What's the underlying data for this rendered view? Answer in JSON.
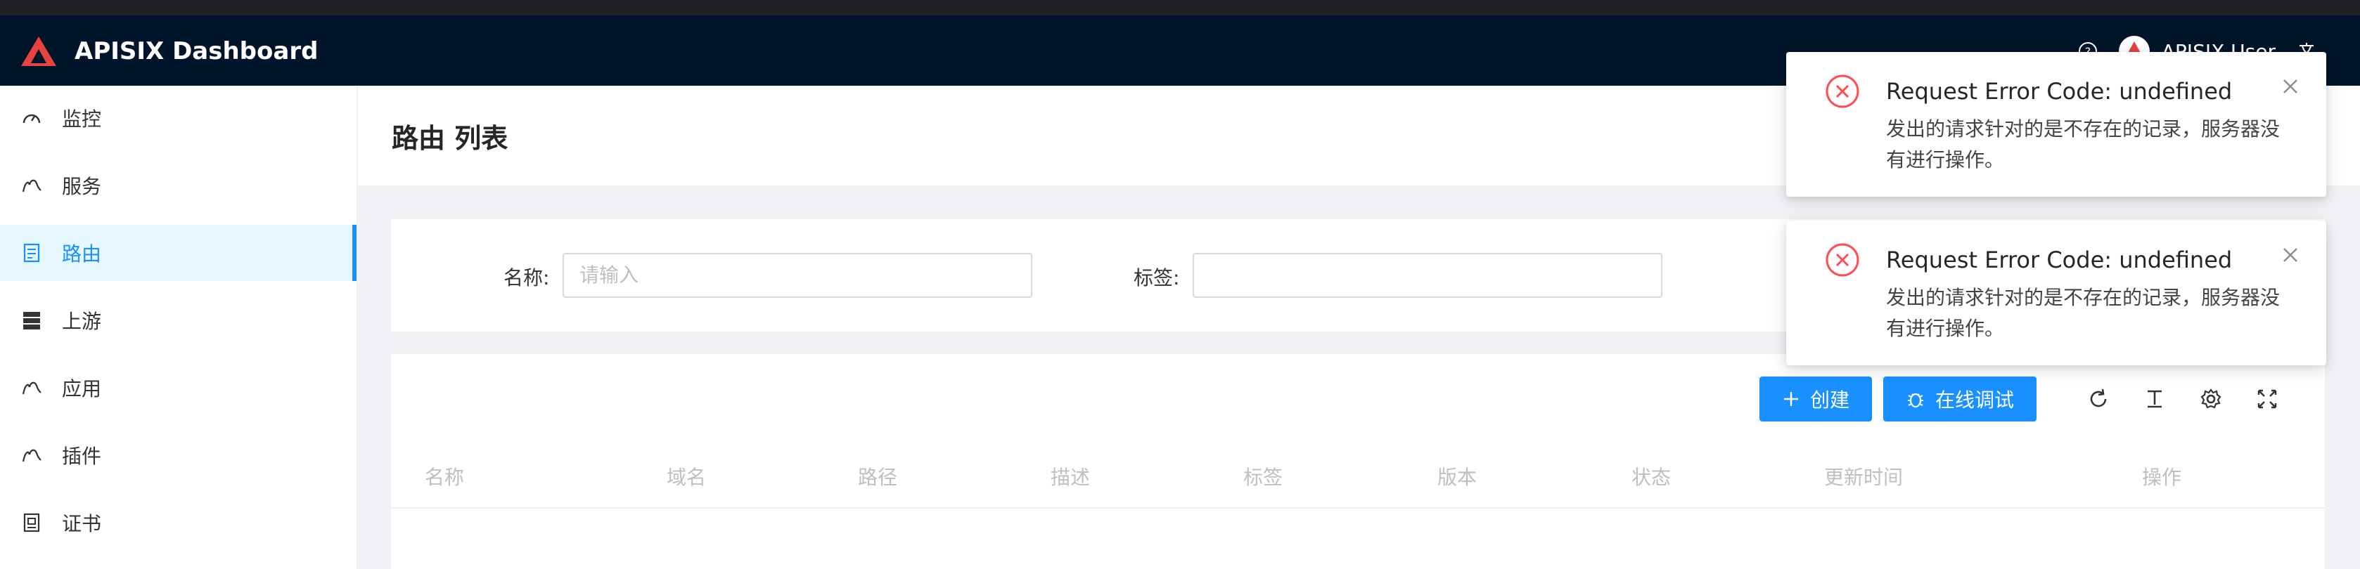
{
  "app": {
    "title": "APISIX Dashboard"
  },
  "header": {
    "user_name": "APISIX User"
  },
  "sidebar": {
    "items": [
      {
        "label": "监控",
        "icon": "dashboard-icon"
      },
      {
        "label": "服务",
        "icon": "service-icon"
      },
      {
        "label": "路由",
        "icon": "route-icon",
        "active": true
      },
      {
        "label": "上游",
        "icon": "upstream-icon"
      },
      {
        "label": "应用",
        "icon": "consumer-icon"
      },
      {
        "label": "插件",
        "icon": "plugin-icon"
      },
      {
        "label": "证书",
        "icon": "certificate-icon"
      }
    ]
  },
  "page": {
    "title": "路由 列表"
  },
  "search": {
    "name_label": "名称:",
    "name_placeholder": "请输入",
    "labels_label": "标签:"
  },
  "toolbar": {
    "create_label": "创建",
    "debug_label": "在线调试"
  },
  "table": {
    "columns": [
      "名称",
      "域名",
      "路径",
      "描述",
      "标签",
      "版本",
      "状态",
      "更新时间",
      "操作"
    ]
  },
  "notifications": [
    {
      "message": "Request Error Code: undefined",
      "description": "发出的请求针对的是不存在的记录，服务器没有进行操作。"
    },
    {
      "message": "Request Error Code: undefined",
      "description": "发出的请求针对的是不存在的记录，服务器没有进行操作。"
    }
  ],
  "colors": {
    "header_bg": "#001529",
    "primary": "#1890ff",
    "error": "#ff4d4f",
    "logo": "#e8433e"
  }
}
